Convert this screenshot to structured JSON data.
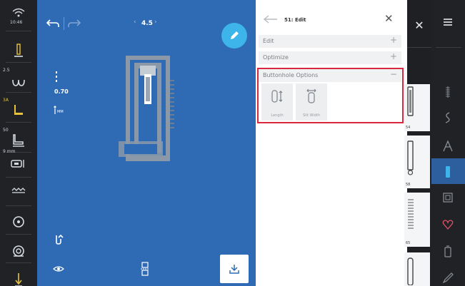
{
  "left_tools": {
    "time": "10:46",
    "speed_value": "2.5",
    "presser_value": "3A",
    "tension_value": "50",
    "buttonhole_value": "9 mm"
  },
  "canvas": {
    "zoom_value": "4.5",
    "width_value": "0.70"
  },
  "panel": {
    "title": "51: Edit",
    "sections": [
      {
        "label": "Edit",
        "sign": "+"
      },
      {
        "label": "Optimize",
        "sign": "+"
      },
      {
        "label": "Buttonhole Options",
        "sign": "−"
      }
    ],
    "options": [
      {
        "label": "Length",
        "icon": "buttonhole-length-icon"
      },
      {
        "label": "Slit Width",
        "icon": "slit-width-icon"
      }
    ]
  },
  "stitches": [
    {
      "number": "54"
    },
    {
      "number": "58"
    },
    {
      "number": "65"
    }
  ],
  "colors": {
    "canvas_blue": "#2f6bb5",
    "fab_blue": "#3db4ea",
    "highlight_red": "#d9273d",
    "favorite_pink": "#e0506a"
  }
}
